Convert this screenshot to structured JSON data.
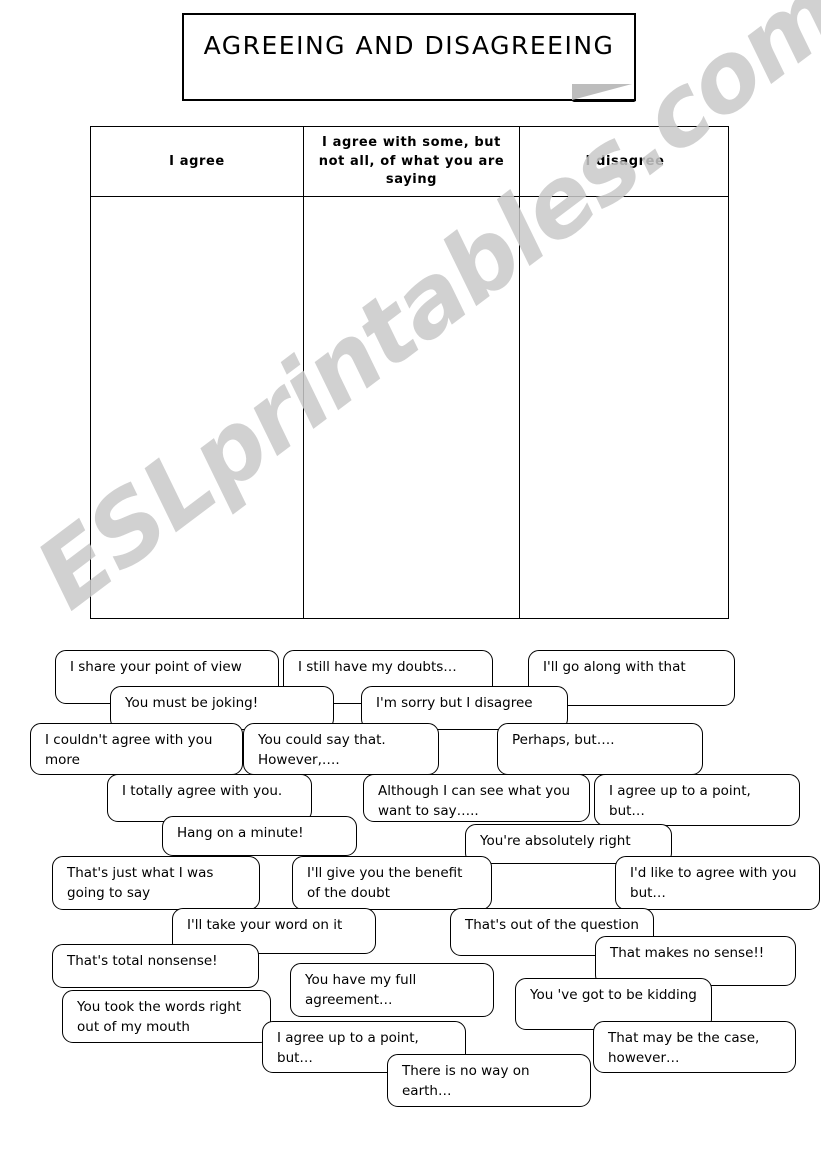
{
  "page": {
    "title": "AGREEING AND DISAGREEING",
    "watermark": "ESLprintables.com"
  },
  "table": {
    "headers": [
      "I agree",
      "I agree with some, but not all, of what you are saying",
      "I disagree"
    ]
  },
  "phrases": [
    {
      "text": "I share your point of view"
    },
    {
      "text": "I still have my doubts…"
    },
    {
      "text": "I'll go along with that"
    },
    {
      "text": "You must be joking!"
    },
    {
      "text": "I'm sorry but I disagree"
    },
    {
      "text": "I couldn't agree with you more"
    },
    {
      "text": "You could say that. However,…."
    },
    {
      "text": "Perhaps, but…."
    },
    {
      "text": "I totally agree with you."
    },
    {
      "text": "Although I can see what you want to say….."
    },
    {
      "text": "I agree up to a point, but…"
    },
    {
      "text": "Hang on a minute!"
    },
    {
      "text": "You're absolutely right"
    },
    {
      "text": "That's just what I was going to say"
    },
    {
      "text": "I'll give you the benefit of the doubt"
    },
    {
      "text": "I'd like to agree with you but…"
    },
    {
      "text": "I'll take your word on it"
    },
    {
      "text": "That's out of the question"
    },
    {
      "text": "That's total nonsense!"
    },
    {
      "text": "That  makes no sense!!"
    },
    {
      "text": "You have my full agreement…"
    },
    {
      "text": "You 've got to be kidding"
    },
    {
      "text": "You took the words right out of my mouth"
    },
    {
      "text": "I agree up to a point, but…"
    },
    {
      "text": "That may be the case, however…"
    },
    {
      "text": "There is no way on earth…"
    }
  ],
  "colors": {
    "ink": "#000000",
    "paper": "#ffffff",
    "watermark": "#c9c9c9",
    "fold": "#bdbdbd"
  }
}
